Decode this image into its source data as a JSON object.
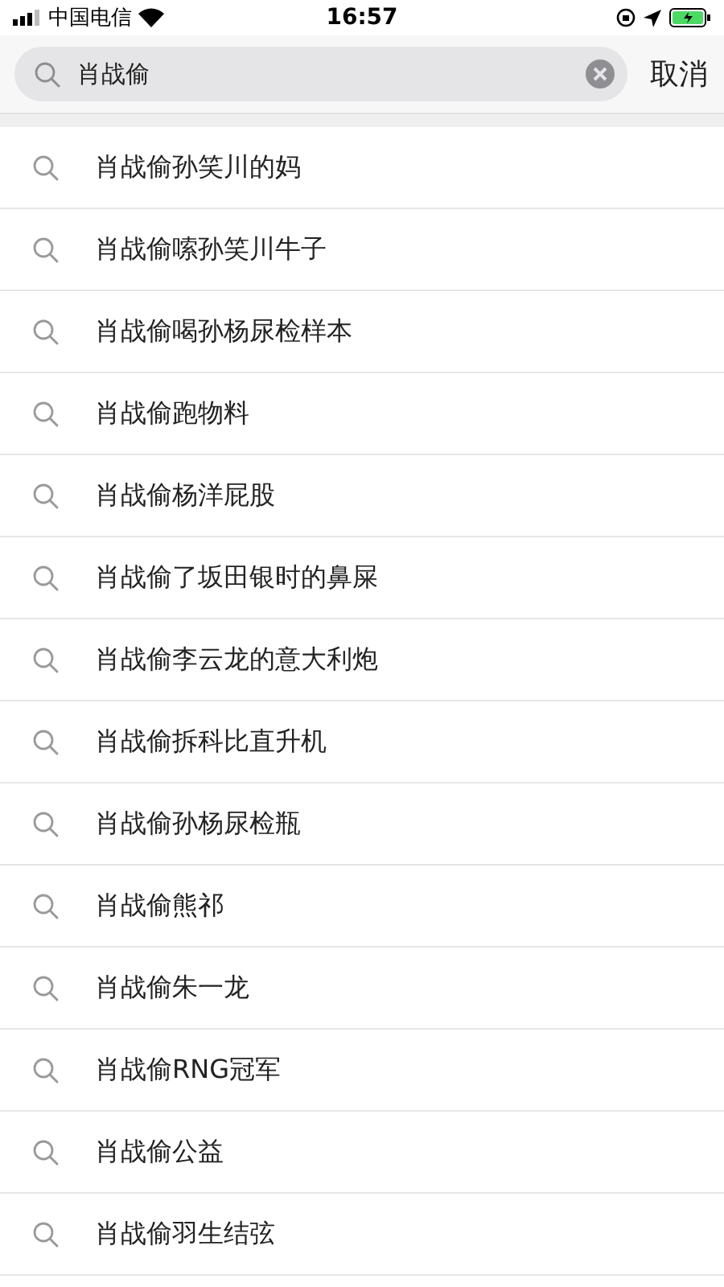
{
  "status_bar": {
    "carrier": "中国电信",
    "time": "16:57"
  },
  "search": {
    "value": "肖战偷",
    "cancel": "取消"
  },
  "suggestions": [
    {
      "text": "肖战偷孙笑川的妈"
    },
    {
      "text": "肖战偷嗦孙笑川牛子"
    },
    {
      "text": "肖战偷喝孙杨尿检样本"
    },
    {
      "text": "肖战偷跑物料"
    },
    {
      "text": "肖战偷杨洋屁股"
    },
    {
      "text": "肖战偷了坂田银时的鼻屎"
    },
    {
      "text": "肖战偷李云龙的意大利炮"
    },
    {
      "text": "肖战偷拆科比直升机"
    },
    {
      "text": "肖战偷孙杨尿检瓶"
    },
    {
      "text": "肖战偷熊祁"
    },
    {
      "text": "肖战偷朱一龙"
    },
    {
      "text": "肖战偷RNG冠军"
    },
    {
      "text": "肖战偷公益"
    },
    {
      "text": "肖战偷羽生结弦"
    }
  ]
}
